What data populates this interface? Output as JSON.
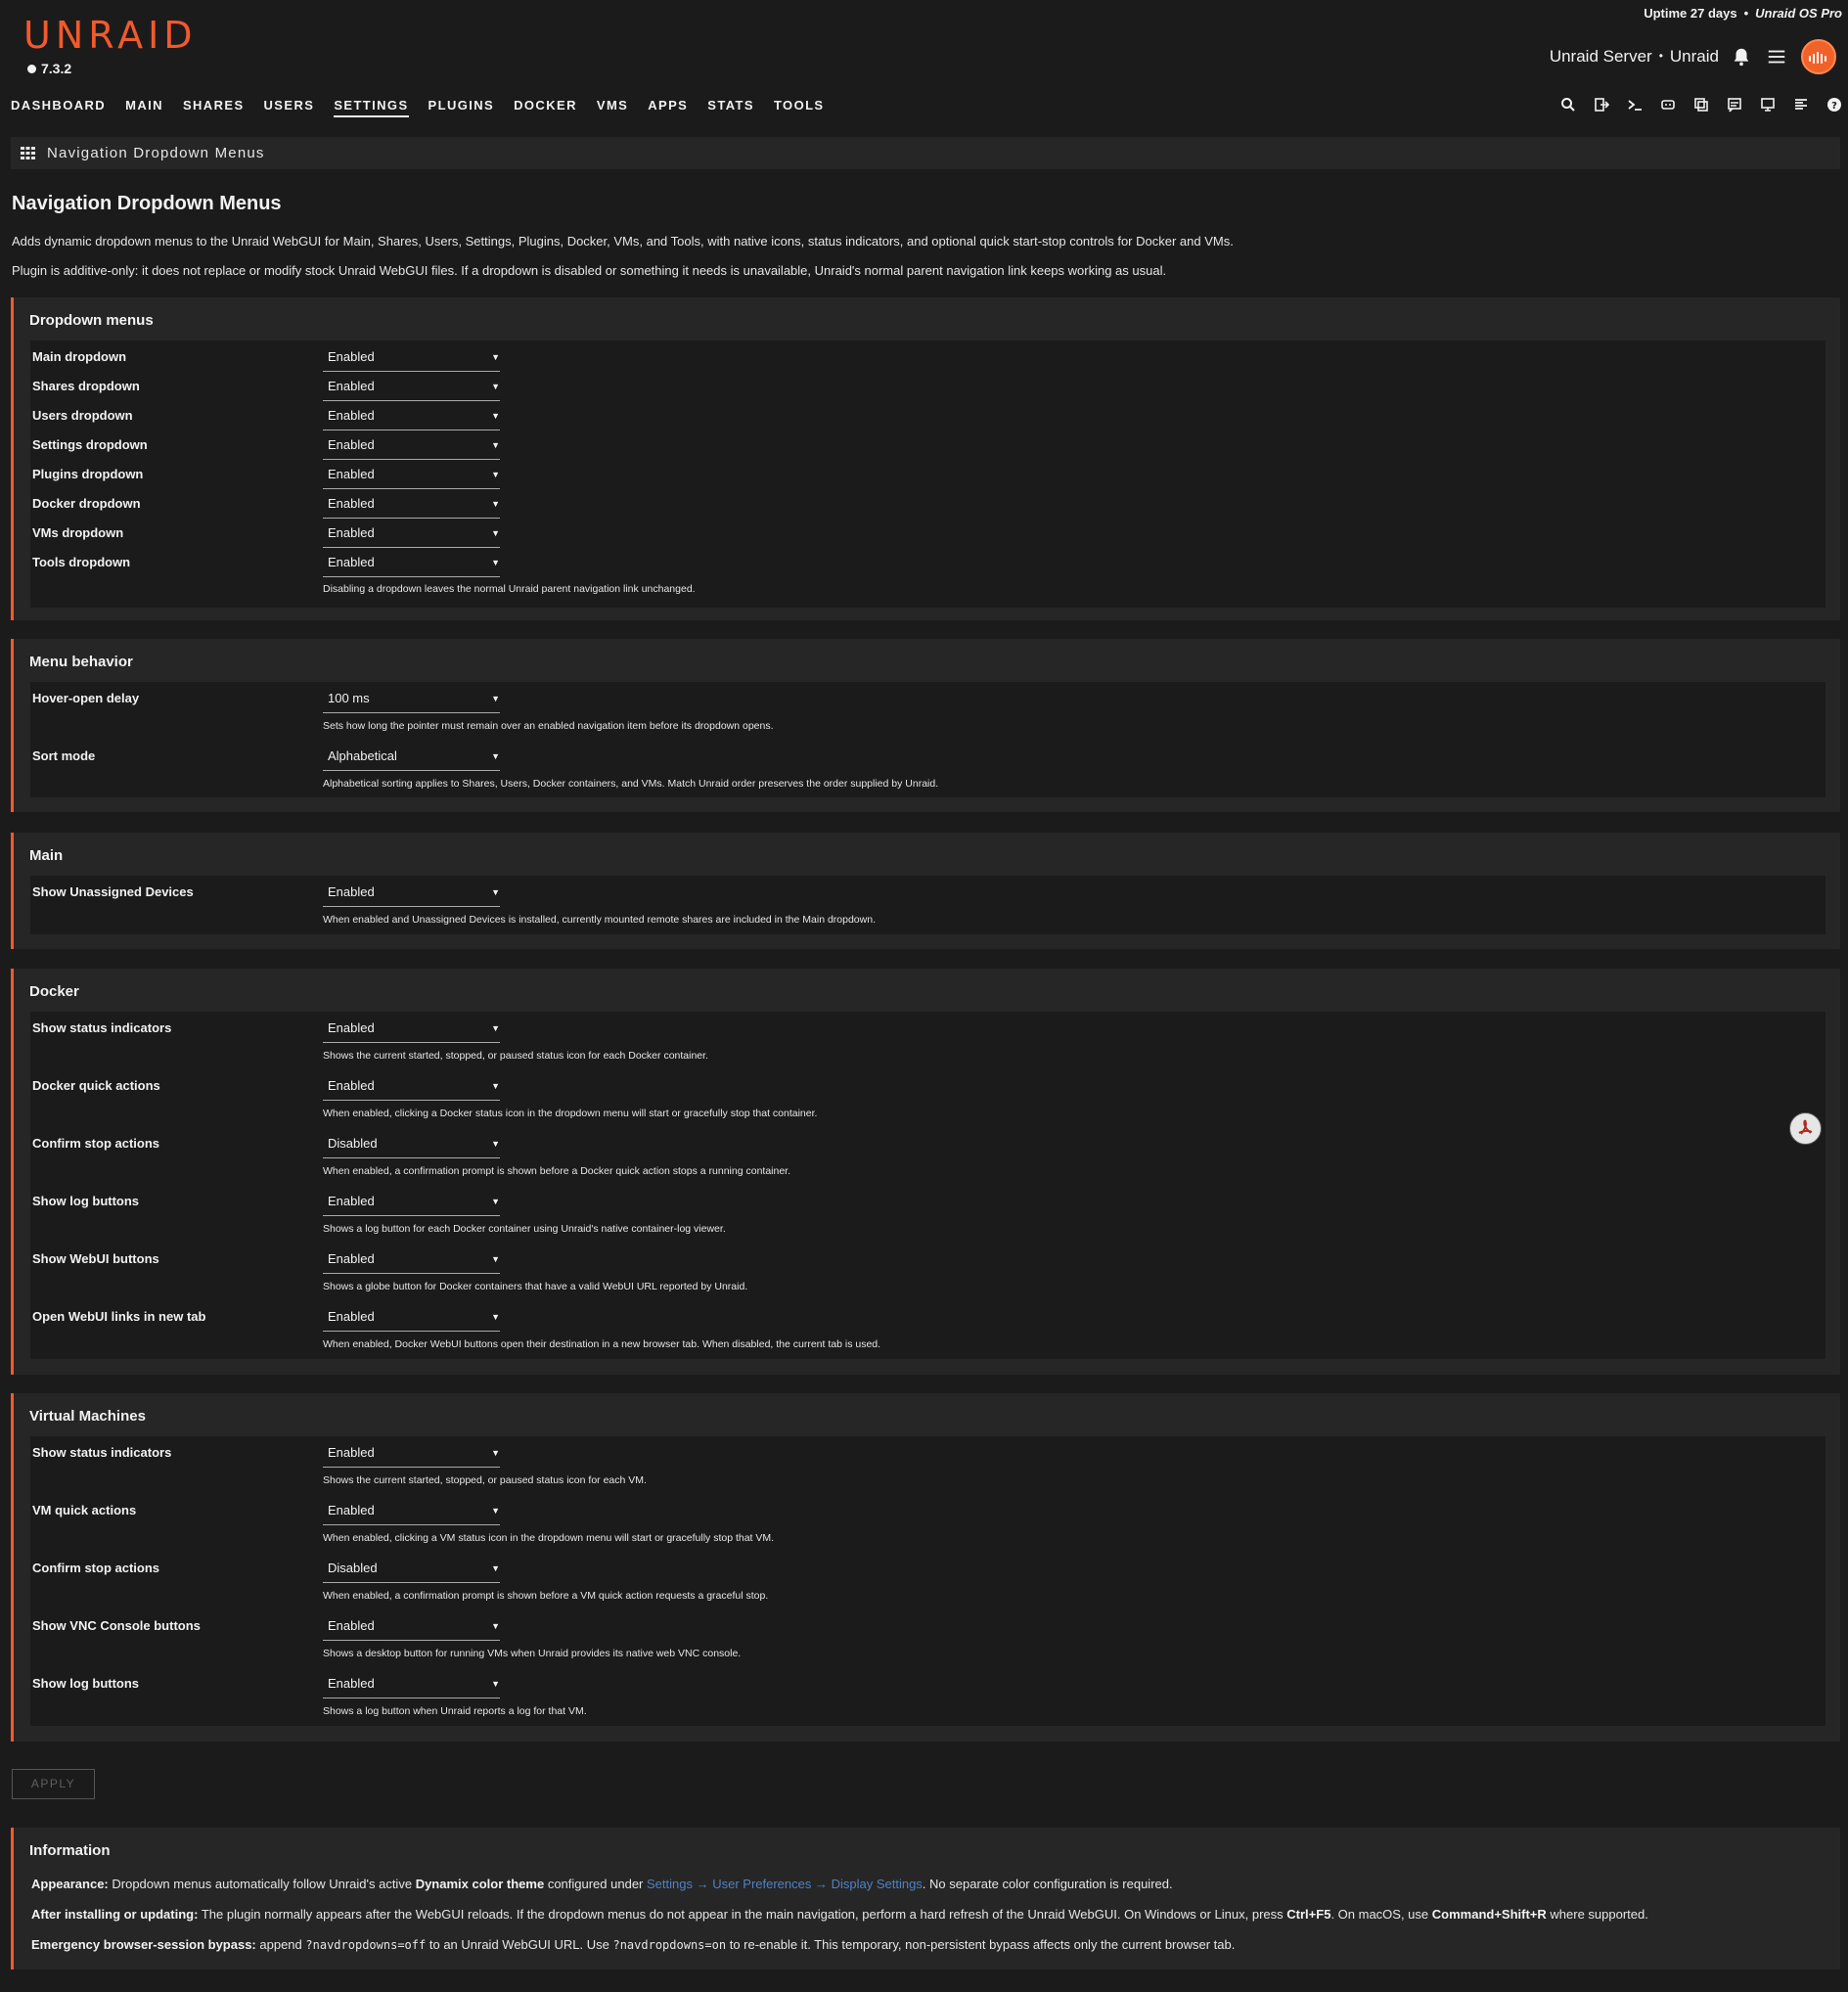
{
  "header": {
    "logo": "UNRAID",
    "version": "7.3.2",
    "uptime": "Uptime 27 days",
    "os_edition": "Unraid OS Pro",
    "server_name": "Unraid Server",
    "server_desc": "Unraid"
  },
  "nav": [
    "DASHBOARD",
    "MAIN",
    "SHARES",
    "USERS",
    "SETTINGS",
    "PLUGINS",
    "DOCKER",
    "VMS",
    "APPS",
    "STATS",
    "TOOLS"
  ],
  "nav_active": "SETTINGS",
  "tab_title": "Navigation Dropdown Menus",
  "page_title": "Navigation Dropdown Menus",
  "intro": [
    "Adds dynamic dropdown menus to the Unraid WebGUI for Main, Shares, Users, Settings, Plugins, Docker, VMs, and Tools, with native icons, status indicators, and optional quick start-stop controls for Docker and VMs.",
    "Plugin is additive-only: it does not replace or modify stock Unraid WebGUI files. If a dropdown is disabled or something it needs is unavailable, Unraid's normal parent navigation link keeps working as usual."
  ],
  "sections": {
    "dropdowns": {
      "title": "Dropdown menus",
      "rows": [
        {
          "label": "Main dropdown",
          "value": "Enabled"
        },
        {
          "label": "Shares dropdown",
          "value": "Enabled"
        },
        {
          "label": "Users dropdown",
          "value": "Enabled"
        },
        {
          "label": "Settings dropdown",
          "value": "Enabled"
        },
        {
          "label": "Plugins dropdown",
          "value": "Enabled"
        },
        {
          "label": "Docker dropdown",
          "value": "Enabled"
        },
        {
          "label": "VMs dropdown",
          "value": "Enabled"
        },
        {
          "label": "Tools dropdown",
          "value": "Enabled"
        }
      ],
      "help": "Disabling a dropdown leaves the normal Unraid parent navigation link unchanged."
    },
    "behavior": {
      "title": "Menu behavior",
      "rows": [
        {
          "label": "Hover-open delay",
          "value": "100 ms",
          "help": "Sets how long the pointer must remain over an enabled navigation item before its dropdown opens."
        },
        {
          "label": "Sort mode",
          "value": "Alphabetical",
          "help": "Alphabetical sorting applies to Shares, Users, Docker containers, and VMs. Match Unraid order preserves the order supplied by Unraid."
        }
      ]
    },
    "main": {
      "title": "Main",
      "rows": [
        {
          "label": "Show Unassigned Devices",
          "value": "Enabled",
          "help": "When enabled and Unassigned Devices is installed, currently mounted remote shares are included in the Main dropdown."
        }
      ]
    },
    "docker": {
      "title": "Docker",
      "rows": [
        {
          "label": "Show status indicators",
          "value": "Enabled",
          "help": "Shows the current started, stopped, or paused status icon for each Docker container."
        },
        {
          "label": "Docker quick actions",
          "value": "Enabled",
          "help": "When enabled, clicking a Docker status icon in the dropdown menu will start or gracefully stop that container."
        },
        {
          "label": "Confirm stop actions",
          "value": "Disabled",
          "help": "When enabled, a confirmation prompt is shown before a Docker quick action stops a running container."
        },
        {
          "label": "Show log buttons",
          "value": "Enabled",
          "help": "Shows a log button for each Docker container using Unraid's native container-log viewer."
        },
        {
          "label": "Show WebUI buttons",
          "value": "Enabled",
          "help": "Shows a globe button for Docker containers that have a valid WebUI URL reported by Unraid."
        },
        {
          "label": "Open WebUI links in new tab",
          "value": "Enabled",
          "help": "When enabled, Docker WebUI buttons open their destination in a new browser tab. When disabled, the current tab is used."
        }
      ]
    },
    "vms": {
      "title": "Virtual Machines",
      "rows": [
        {
          "label": "Show status indicators",
          "value": "Enabled",
          "help": "Shows the current started, stopped, or paused status icon for each VM."
        },
        {
          "label": "VM quick actions",
          "value": "Enabled",
          "help": "When enabled, clicking a VM status icon in the dropdown menu will start or gracefully stop that VM."
        },
        {
          "label": "Confirm stop actions",
          "value": "Disabled",
          "help": "When enabled, a confirmation prompt is shown before a VM quick action requests a graceful stop."
        },
        {
          "label": "Show VNC Console buttons",
          "value": "Enabled",
          "help": "Shows a desktop button for running VMs when Unraid provides its native web VNC console."
        },
        {
          "label": "Show log buttons",
          "value": "Enabled",
          "help": "Shows a log button when Unraid reports a log for that VM."
        }
      ]
    }
  },
  "apply_label": "APPLY",
  "info": {
    "title": "Information",
    "appearance_label": "Appearance:",
    "appearance_text1": "Dropdown menus automatically follow Unraid's active",
    "appearance_bold": "Dynamix color theme",
    "appearance_text2": "configured under",
    "appearance_link": "Settings → User Preferences → Display Settings",
    "appearance_text3": ". No separate color configuration is required.",
    "install_label": "After installing or updating:",
    "install_text1": "The plugin normally appears after the WebGUI reloads. If the dropdown menus do not appear in the main navigation, perform a hard refresh of the Unraid WebGUI. On Windows or Linux, press",
    "install_key1": "Ctrl+F5",
    "install_text2": ". On macOS, use",
    "install_key2": "Command+Shift+R",
    "install_text3": "where supported.",
    "bypass_label": "Emergency browser-session bypass:",
    "bypass_text1": "append",
    "bypass_code1": "?navdropdowns=off",
    "bypass_text2": "to an Unraid WebGUI URL. Use",
    "bypass_code2": "?navdropdowns=on",
    "bypass_text3": "to re-enable it. This temporary, non-persistent bypass affects only the current browser tab."
  },
  "icons": [
    "search-icon",
    "logout-icon",
    "terminal-icon",
    "feedback-icon",
    "copy-icon",
    "notes-icon",
    "display-icon",
    "log-icon",
    "help-icon",
    "bell-icon",
    "menu-icon",
    "pdf-icon"
  ],
  "colors": {
    "accent": "#f15a2c",
    "link": "#4f82c3",
    "background": "#1c1b1c",
    "panel": "#262627"
  }
}
